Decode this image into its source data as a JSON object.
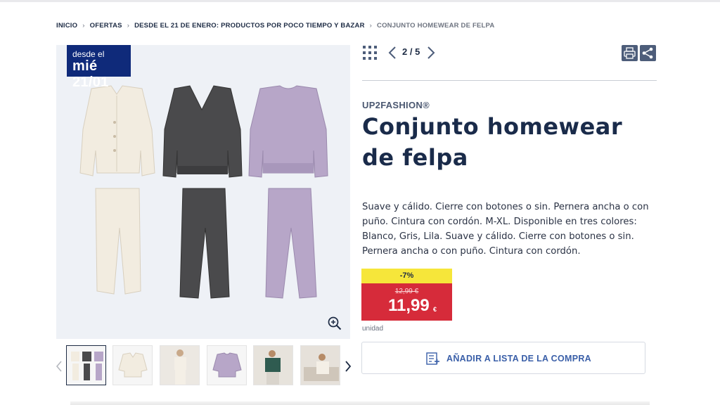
{
  "breadcrumb": {
    "items": [
      "INICIO",
      "OFERTAS",
      "DESDE EL 21 DE ENERO: PRODUCTOS POR POCO TIEMPO Y BAZAR"
    ],
    "current": "CONJUNTO HOMEWEAR DE FELPA"
  },
  "badge": {
    "line1": "desde el",
    "line2": "mié 21/01"
  },
  "gallery": {
    "pager": "2 / 5",
    "thumbnails": [
      "thumb-outfit-set",
      "thumb-cardigan",
      "thumb-model-white",
      "thumb-lilac-sweater",
      "thumb-model-green",
      "thumb-model-sofa"
    ]
  },
  "product": {
    "brand": "UP2FASHION®",
    "title": "Conjunto homewear de felpa",
    "description": "Suave y cálido. Cierre con botones o sin. Pernera ancha o con puño. Cintura con cordón. M-XL. Disponible en tres colores: Blanco, Gris, Lila. Suave y cálido. Cierre con botones o sin. Pernera ancha o con puño. Cintura con cordón."
  },
  "price": {
    "discount": "-7%",
    "old": "12,99 €",
    "new": "11,99",
    "currency": "€",
    "unit": "unidad"
  },
  "actions": {
    "add_to_list": "AÑADIR A LISTA DE LA COMPRA"
  },
  "colors": {
    "navy": "#1a2b4a",
    "badge": "#0f2a7a",
    "price_red": "#d62b3a",
    "discount_yellow": "#f6e63a",
    "link_blue": "#3a5fa8"
  },
  "icons": [
    "chevron-right-icon",
    "zoom-in-icon",
    "grid-icon",
    "chevron-left-icon",
    "print-icon",
    "share-icon",
    "list-add-icon"
  ]
}
